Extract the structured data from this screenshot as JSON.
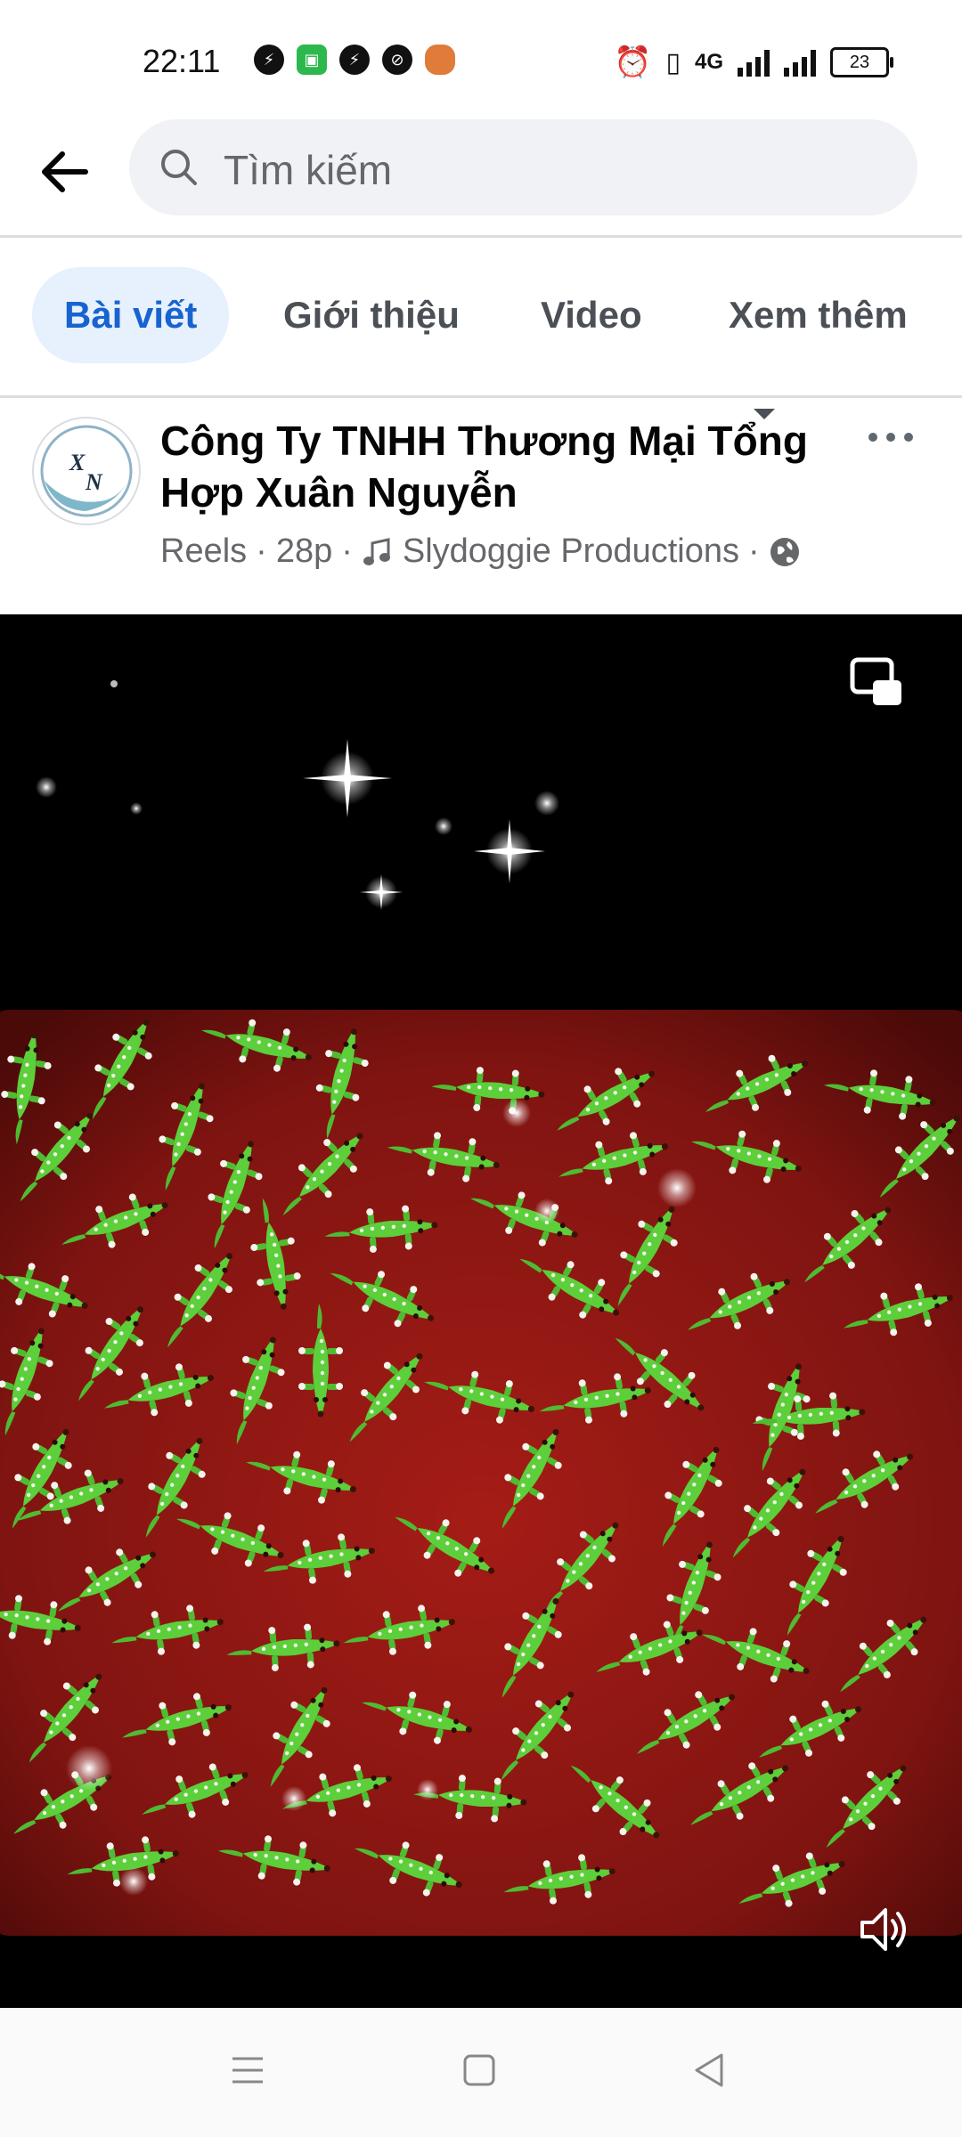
{
  "status_bar": {
    "time": "22:11",
    "network": "4G",
    "battery": "23"
  },
  "search": {
    "placeholder": "Tìm kiếm"
  },
  "tabs": [
    {
      "label": "Bài viết",
      "active": true
    },
    {
      "label": "Giới thiệu",
      "active": false
    },
    {
      "label": "Video",
      "active": false
    },
    {
      "label": "Xem thêm",
      "active": false
    }
  ],
  "post": {
    "page_name": "Công Ty TNHH Thương Mại Tổng Hợp Xuân Nguyễn",
    "type": "Reels",
    "time": "28p",
    "audio": "Slydoggie Productions",
    "sep": "·"
  },
  "colors": {
    "accent": "#1763cf",
    "tab_active_bg": "#e7f0fd",
    "tray_red": "#8b1512",
    "crocodile_green": "#5ccf3b"
  },
  "icons": [
    "back-arrow-icon",
    "search-icon",
    "more-icon",
    "music-note-icon",
    "globe-icon",
    "pip-icon",
    "sound-icon",
    "menu-icon",
    "home-icon",
    "back-icon"
  ]
}
